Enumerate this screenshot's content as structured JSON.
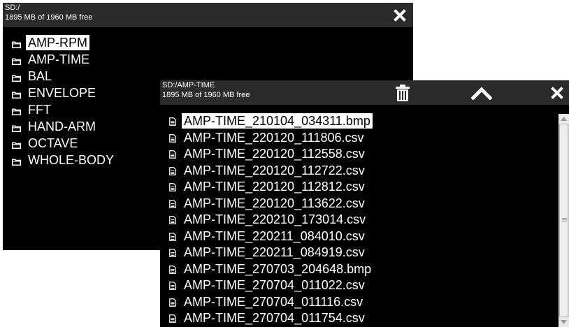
{
  "back_window": {
    "path": "SD:/",
    "free_space": "1895 MB of 1960 MB free",
    "close_icon": "close-icon",
    "folder_icon": "folder-icon",
    "selected_index": 0,
    "folders": [
      {
        "label": "AMP-RPM"
      },
      {
        "label": "AMP-TIME"
      },
      {
        "label": "BAL"
      },
      {
        "label": "ENVELOPE"
      },
      {
        "label": "FFT"
      },
      {
        "label": "HAND-ARM"
      },
      {
        "label": "OCTAVE"
      },
      {
        "label": "WHOLE-BODY"
      }
    ]
  },
  "front_window": {
    "path": "SD:/AMP-TIME",
    "free_space": "1895 MB of 1960 MB free",
    "delete_icon": "trash-icon",
    "up_icon": "chevron-up-icon",
    "close_icon": "close-icon",
    "file_icon": "file-icon",
    "selected_index": 0,
    "scroll_position": 0,
    "files": [
      {
        "label": "AMP-TIME_210104_034311.bmp"
      },
      {
        "label": "AMP-TIME_220120_111806.csv"
      },
      {
        "label": "AMP-TIME_220120_112558.csv"
      },
      {
        "label": "AMP-TIME_220120_112722.csv"
      },
      {
        "label": "AMP-TIME_220120_112812.csv"
      },
      {
        "label": "AMP-TIME_220120_113622.csv"
      },
      {
        "label": "AMP-TIME_220210_173014.csv"
      },
      {
        "label": "AMP-TIME_220211_084010.csv"
      },
      {
        "label": "AMP-TIME_220211_084919.csv"
      },
      {
        "label": "AMP-TIME_270703_204648.bmp"
      },
      {
        "label": "AMP-TIME_270704_011022.csv"
      },
      {
        "label": "AMP-TIME_270704_011116.csv"
      },
      {
        "label": "AMP-TIME_270704_011754.csv"
      }
    ]
  },
  "colors": {
    "window_bg": "#000000",
    "titlebar_bg": "#2b2b2b",
    "text": "#ffffff",
    "selection_bg": "#ffffff",
    "selection_text": "#000000"
  }
}
